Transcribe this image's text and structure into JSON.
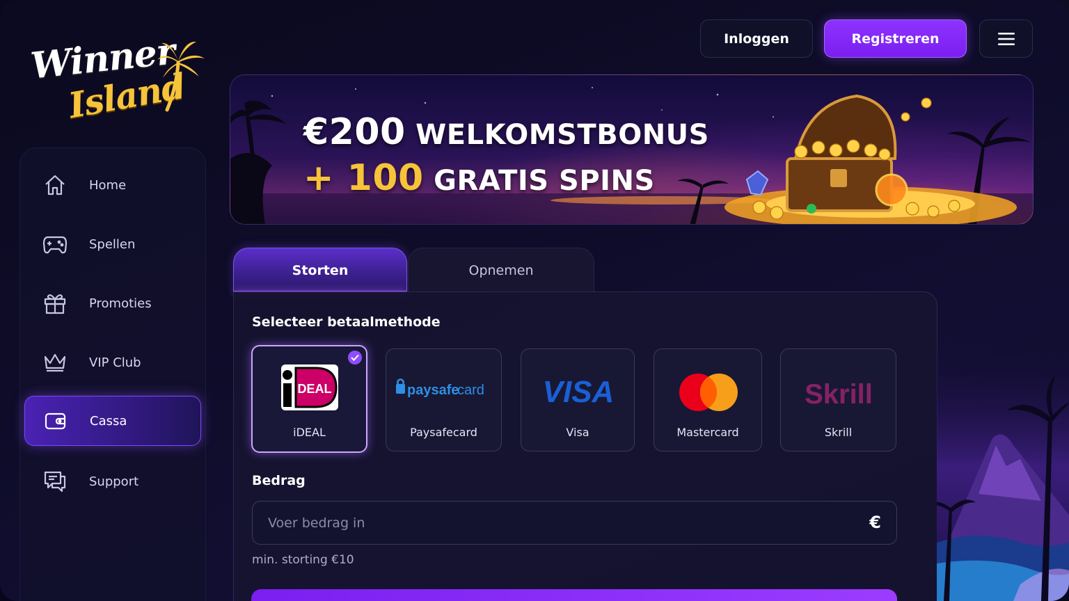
{
  "brand": {
    "line1": "Winner",
    "line2": "Island"
  },
  "header": {
    "login_label": "Inloggen",
    "register_label": "Registreren"
  },
  "sidebar": {
    "items": [
      {
        "label": "Home",
        "icon": "home-icon"
      },
      {
        "label": "Spellen",
        "icon": "gamepad-icon"
      },
      {
        "label": "Promoties",
        "icon": "gift-icon"
      },
      {
        "label": "VIP Club",
        "icon": "crown-icon"
      },
      {
        "label": "Cassa",
        "icon": "wallet-icon",
        "active": true
      },
      {
        "label": "Support",
        "icon": "chat-icon"
      }
    ]
  },
  "banner": {
    "amount": "€200",
    "title1": "WELKOMSTBONUS",
    "plus_amount": "+ 100",
    "title2": "GRATIS SPINS"
  },
  "tabs": [
    {
      "label": "Storten",
      "active": true
    },
    {
      "label": "Opnemen",
      "active": false
    }
  ],
  "payment": {
    "heading": "Selecteer betaalmethode",
    "methods": [
      {
        "name": "iDEAL",
        "logo": "iDEAL",
        "selected": true
      },
      {
        "name": "Paysafecard",
        "logo": "paysafecard"
      },
      {
        "name": "Visa",
        "logo": "VISA"
      },
      {
        "name": "Mastercard",
        "logo": "mastercard"
      },
      {
        "name": "Skrill",
        "logo": "Skrill"
      }
    ]
  },
  "amount": {
    "label": "Bedrag",
    "placeholder": "Voer bedrag in",
    "currency": "€",
    "hint": "min. storting €10"
  },
  "colors": {
    "accent": "#8e32ff",
    "gold": "#f6c33a",
    "background": "#0c0a1f"
  }
}
